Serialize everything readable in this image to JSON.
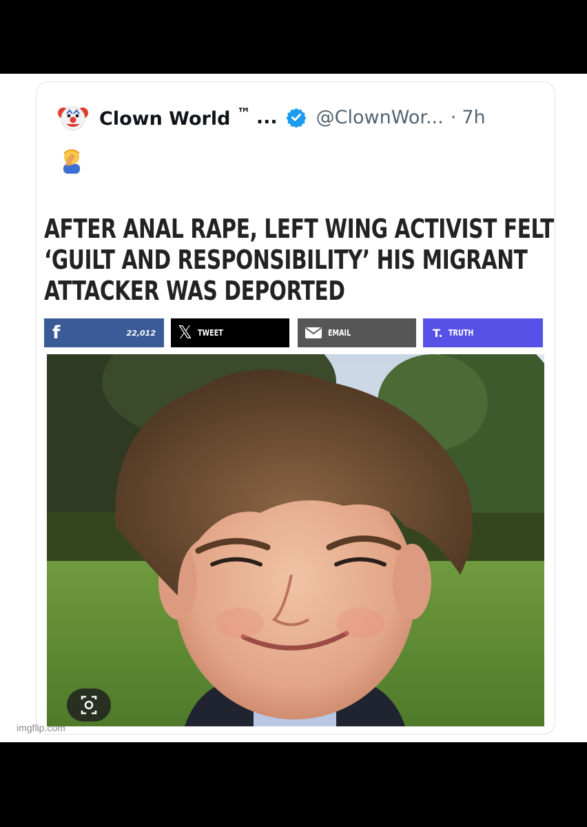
{
  "tweet": {
    "display_name": "Clown World",
    "trademark": "™",
    "ellipsis": "...",
    "handle": "@ClownWor...",
    "separator": "·",
    "age": "7h",
    "avatar_icon": "clown-face-icon",
    "verified_icon": "verified-badge-icon",
    "body_icon": "facepalm-emoji-icon"
  },
  "article": {
    "headline_lines": [
      "AFTER ANAL RAPE, LEFT WING ACTIVIST FELT",
      "‘GUILT AND RESPONSIBILITY’ HIS MIGRANT",
      "ATTACKER WAS DEPORTED"
    ],
    "share": {
      "facebook_count": "22,012",
      "tweet_label": "TWEET",
      "email_label": "EMAIL",
      "truth_label": "TRUTH"
    },
    "colors": {
      "facebook": "#3b5b98",
      "x": "#000000",
      "email": "#565656",
      "truth": "#5751e8"
    },
    "photo_icon": "google-lens-icon"
  },
  "watermark": "imgflip.com"
}
